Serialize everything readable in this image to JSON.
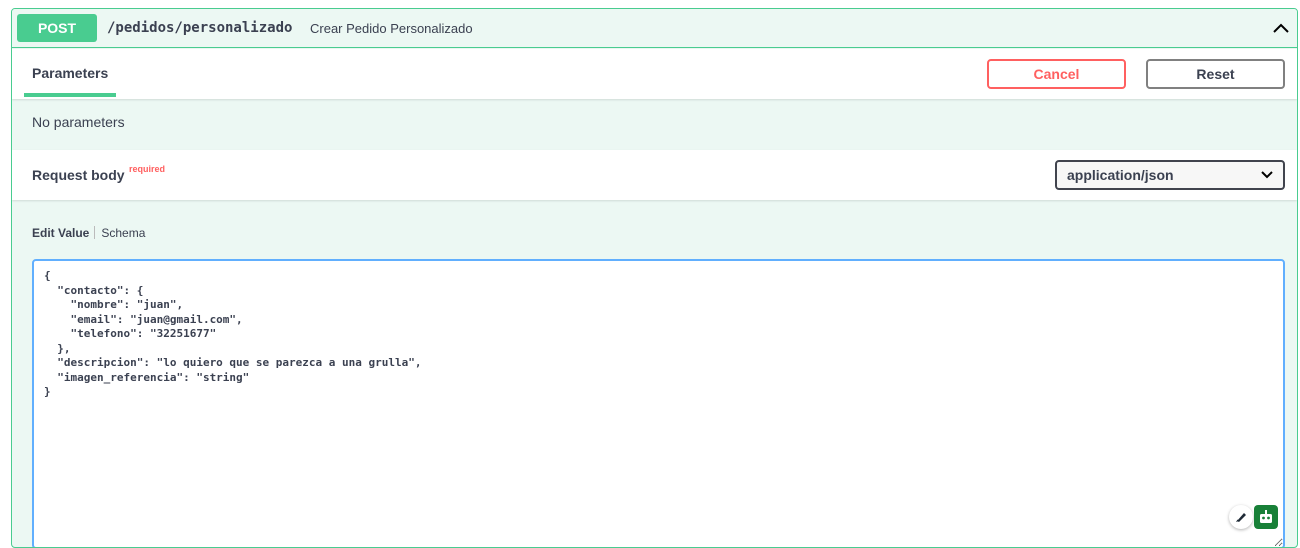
{
  "operation": {
    "method": "POST",
    "path": "/pedidos/personalizado",
    "summary": "Crear Pedido Personalizado"
  },
  "parameters": {
    "tab_label": "Parameters",
    "cancel_label": "Cancel",
    "reset_label": "Reset",
    "empty_text": "No parameters"
  },
  "request_body": {
    "title": "Request body",
    "required_label": "required",
    "content_type": "application/json",
    "tabs": [
      "Edit Value",
      "Schema"
    ],
    "value": "{\n  \"contacto\": {\n    \"nombre\": \"juan\",\n    \"email\": \"juan@gmail.com\",\n    \"telefono\": \"32251677\"\n  },\n  \"descripcion\": \"lo quiero que se parezca a una grulla\",\n  \"imagen_referencia\": \"string\"\n}"
  },
  "colors": {
    "post": "#49cc90",
    "cancel": "#ff6060",
    "editor_border": "#61affe"
  },
  "icons": [
    "chevron-up-icon",
    "chevron-down-icon",
    "pen-icon",
    "robot-icon"
  ]
}
